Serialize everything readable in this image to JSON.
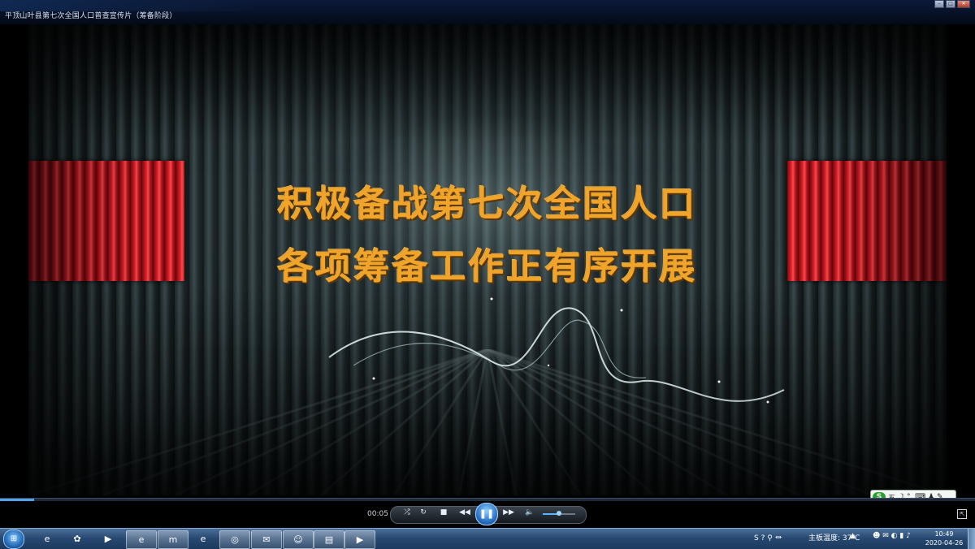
{
  "window": {
    "title": "平顶山叶县第七次全国人口普查宣传片（筹备阶段）",
    "buttons": [
      "–",
      "□",
      "✕"
    ]
  },
  "video": {
    "headline_line1": "积极备战第七次全国人口",
    "headline_line2": "各项筹备工作正有序开展"
  },
  "player": {
    "elapsed": "00:05",
    "progress_fraction": 0.035,
    "volume_fraction": 0.5,
    "buttons": {
      "shuffle": "⤮",
      "repeat": "↻",
      "stop": "■",
      "rewind": "◀◀",
      "pause": "❚❚",
      "fast_forward": "▶▶",
      "volume": "🔈",
      "fullscreen": "⇱"
    }
  },
  "ime": {
    "logo": "S",
    "mode": "五",
    "icons": "☽ °, ⌨ ♟ ✎"
  },
  "taskbar": {
    "start": "⊞",
    "apps": [
      {
        "name": "ie",
        "glyph": "e"
      },
      {
        "name": "baidu-netdisk",
        "glyph": "✿"
      },
      {
        "name": "media-player",
        "glyph": "▶"
      },
      {
        "name": "360-browser",
        "glyph": "e"
      },
      {
        "name": "maxthon",
        "glyph": "m"
      },
      {
        "name": "ie-2",
        "glyph": "e"
      },
      {
        "name": "qq-browser",
        "glyph": "◎"
      },
      {
        "name": "wechat",
        "glyph": "✉"
      },
      {
        "name": "qq-chat",
        "glyph": "☺"
      },
      {
        "name": "file-explorer",
        "glyph": "▤"
      },
      {
        "name": "video-player",
        "glyph": "▶"
      }
    ],
    "tray_left": "S ? ⚲ ⏛",
    "board_temp": "主板温度: 37℃",
    "tray_caret": "▲",
    "tray_right": "☻ ✉ ◐ ▮ ♪",
    "time": "10:49",
    "date": "2020-04-26"
  }
}
